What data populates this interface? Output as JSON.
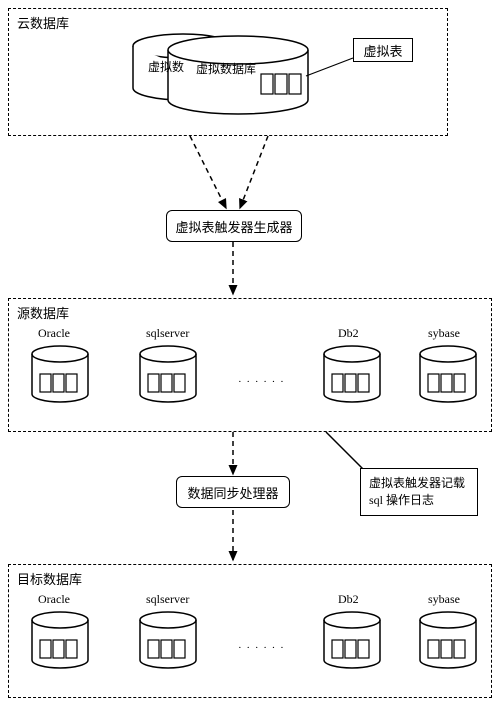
{
  "cloud": {
    "title": "云数据库",
    "back_db_label": "虚拟数",
    "front_db_label": "虚拟数据库",
    "virtual_table_label": "虚拟表"
  },
  "generator": {
    "label": "虚拟表触发器生成器"
  },
  "source": {
    "title": "源数据库",
    "dbs": [
      "Oracle",
      "sqlserver",
      "Db2",
      "sybase"
    ],
    "ellipsis": "· · · · · ·"
  },
  "sync": {
    "label": "数据同步处理器"
  },
  "annotation": {
    "text": "虚拟表触发器记载 sql 操作日志"
  },
  "target": {
    "title": "目标数据库",
    "dbs": [
      "Oracle",
      "sqlserver",
      "Db2",
      "sybase"
    ],
    "ellipsis": "· · · · · ·"
  }
}
